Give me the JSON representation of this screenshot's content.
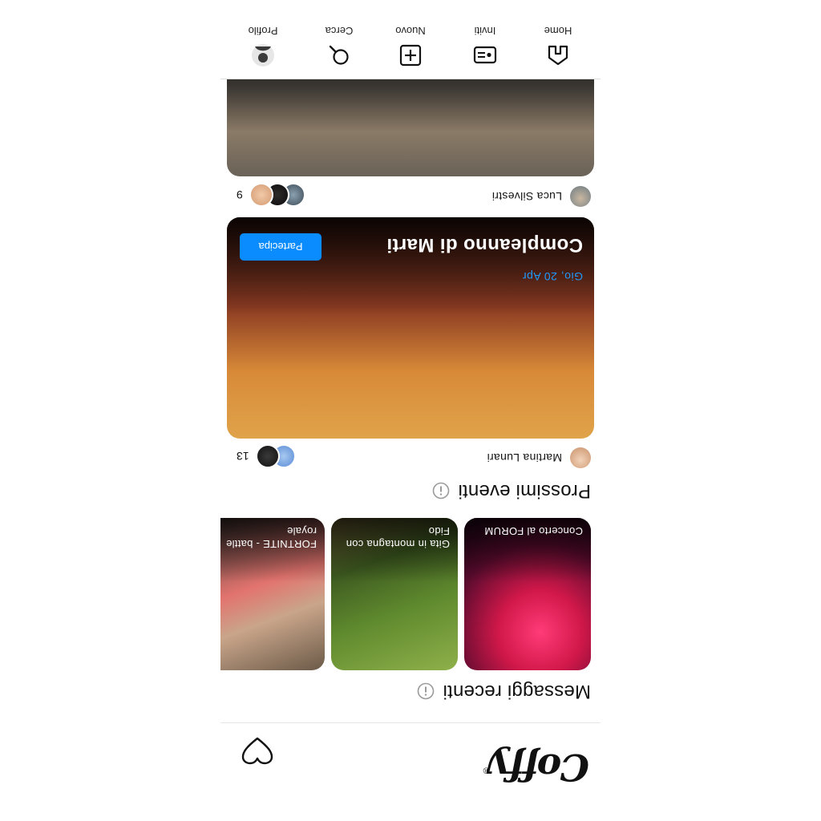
{
  "header": {
    "logo_text": "Coffy",
    "logo_mark": "®"
  },
  "sections": {
    "recent_messages": "Messaggi recenti",
    "upcoming_events": "Prossimi eventi"
  },
  "messages": [
    {
      "caption": "Concerto al FORUM"
    },
    {
      "caption": "Gita in montagna con Fido"
    },
    {
      "caption": "FORTNITE - battle royale"
    }
  ],
  "events": [
    {
      "host": "Martina Lunari",
      "attendees": "13",
      "date": "Gio, 20 Apr",
      "title": "Compleanno di Marti",
      "join_label": "Partecipa"
    },
    {
      "host": "Luca Silvestri",
      "attendees": "9"
    }
  ],
  "nav": {
    "home": "Home",
    "invites": "Inviti",
    "new": "Nuovo",
    "search": "Cerca",
    "profile": "Profilo"
  },
  "colors": {
    "accent": "#0a8cff",
    "date": "#1e9bff"
  }
}
